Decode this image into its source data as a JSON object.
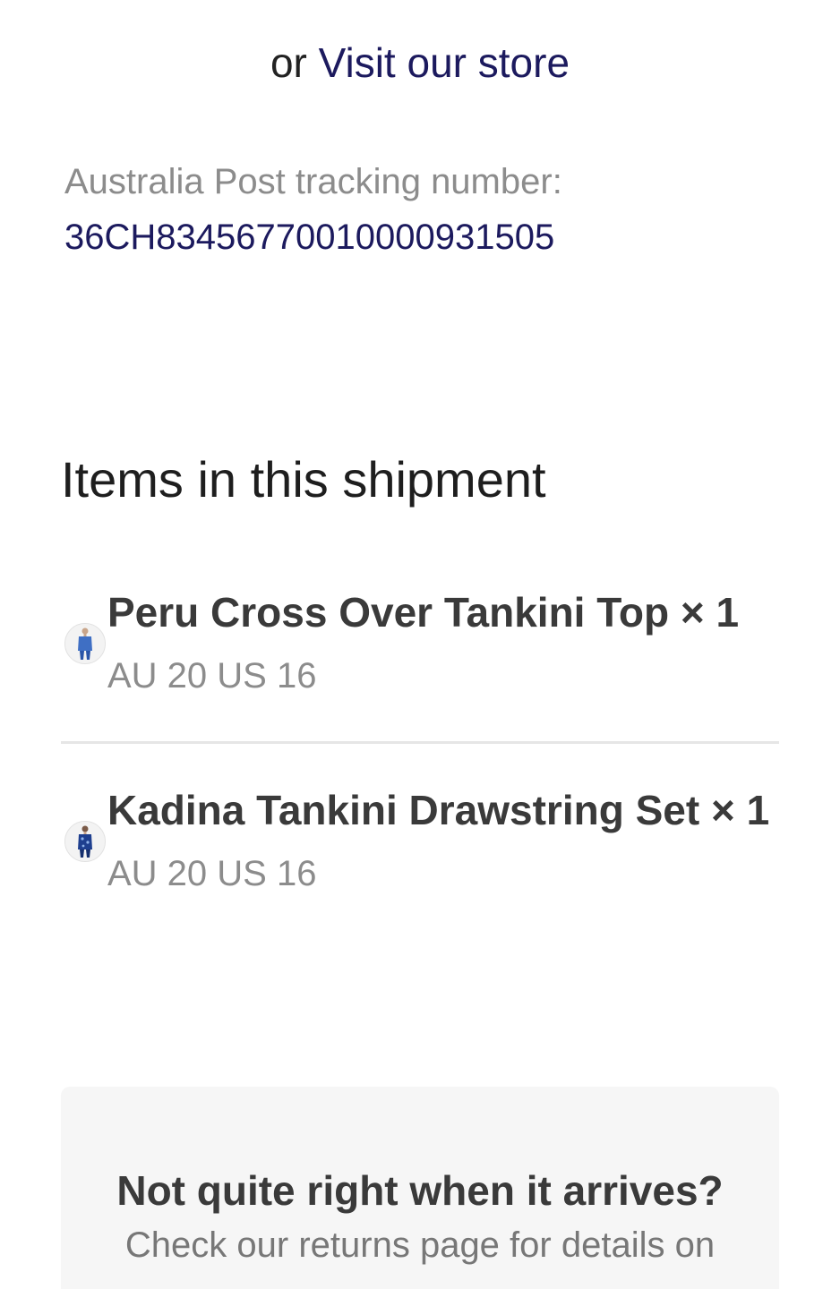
{
  "store_line": {
    "prefix": "or ",
    "link_label": "Visit our store"
  },
  "tracking": {
    "label": "Australia Post tracking number:",
    "number": "36CH83456770010000931505"
  },
  "shipment": {
    "heading": "Items in this shipment",
    "items": [
      {
        "title": "Peru Cross Over Tankini Top × 1",
        "variant": "AU 20 US 16",
        "thumbnail_icon": "swimsuit-thumbnail-icon"
      },
      {
        "title": "Kadina Tankini Drawstring Set × 1",
        "variant": "AU 20 US 16",
        "thumbnail_icon": "swimsuit-thumbnail-icon"
      }
    ]
  },
  "returns": {
    "title": "Not quite right when it arrives?",
    "body": "Check our returns page for details on"
  },
  "colors": {
    "link": "#1c1a5e",
    "muted_text": "#8c8c8c",
    "returns_background": "#f6f6f6"
  }
}
